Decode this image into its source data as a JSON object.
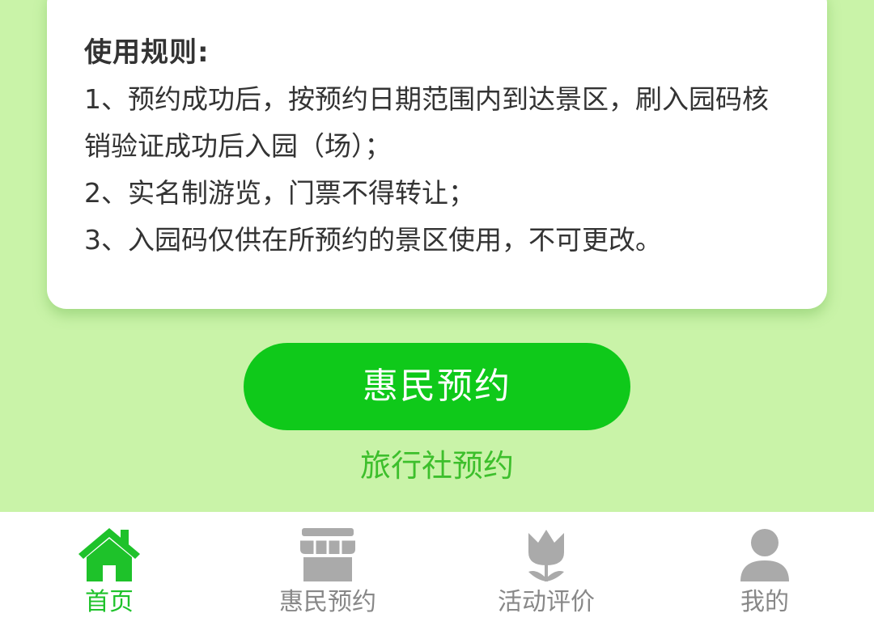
{
  "rules": {
    "title": "使用规则:",
    "lines": [
      "1、预约成功后，按预约日期范围内到达景区，刷入园码核",
      "销验证成功后入园（场）；",
      "2、实名制游览，门票不得转让；",
      "3、入园码仅供在所预约的景区使用，不可更改。"
    ]
  },
  "actions": {
    "reserve_button": "惠民预约",
    "agency_link": "旅行社预约"
  },
  "tabbar": {
    "active_color": "#1ec22a",
    "inactive_color": "#aaaaaa",
    "items": [
      {
        "label": "首页",
        "icon": "home-icon",
        "active": true
      },
      {
        "label": "惠民预约",
        "icon": "shop-icon",
        "active": false
      },
      {
        "label": "活动评价",
        "icon": "tulip-icon",
        "active": false
      },
      {
        "label": "我的",
        "icon": "user-icon",
        "active": false
      }
    ]
  }
}
